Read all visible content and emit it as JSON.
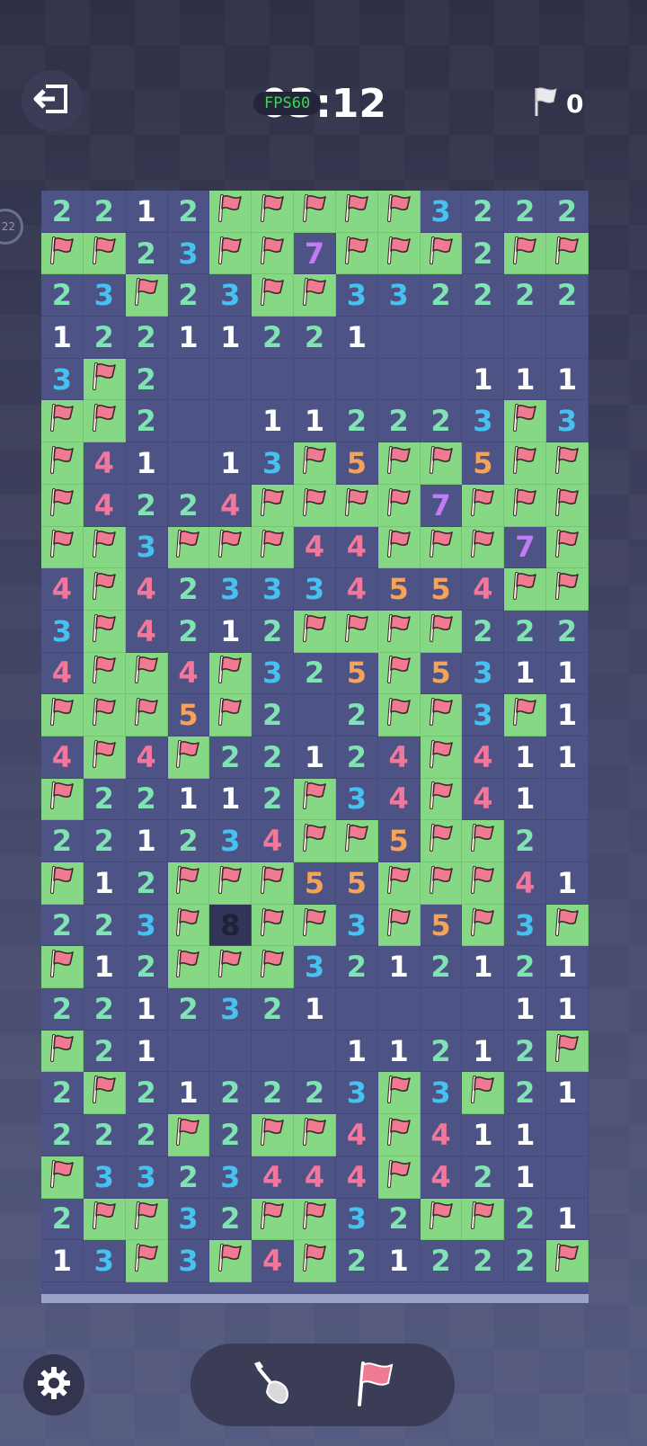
{
  "header": {
    "fps_label": "FPS60",
    "timer": "03:12",
    "flag_count": "0",
    "side_level": "22"
  },
  "colors": {
    "open_cell": "#4d5384",
    "flag_cell": "#86d884",
    "num1": "#ffffff",
    "num2": "#7fe3b4",
    "num3": "#47c2f0",
    "num4": "#f3779c",
    "num5": "#f5a25a",
    "num7": "#c07bf5",
    "num8": "#1f2236",
    "flag_red": "#f07a92"
  },
  "icons": {
    "exit": "exit-icon",
    "flag_counter": "flag-outline-icon",
    "settings": "gear-icon",
    "shovel": "shovel-icon",
    "flag_tool": "flag-icon"
  },
  "board": {
    "rows": [
      [
        "2",
        "2",
        "1",
        "2",
        "F",
        "F",
        "F",
        "F",
        "F",
        "3",
        "2",
        "2",
        "2"
      ],
      [
        "F",
        "F",
        "2",
        "3",
        "F",
        "F",
        "7",
        "F",
        "F",
        "F",
        "2",
        "F",
        "F"
      ],
      [
        "2",
        "3",
        "F",
        "2",
        "3",
        "F",
        "F",
        "3",
        "3",
        "2",
        "2",
        "2",
        "2"
      ],
      [
        "1",
        "2",
        "2",
        "1",
        "1",
        "2",
        "2",
        "1",
        "",
        "",
        "",
        "",
        ""
      ],
      [
        "3",
        "F",
        "2",
        "",
        "",
        "",
        "",
        "",
        "",
        "",
        "1",
        "1",
        "1"
      ],
      [
        "F",
        "F",
        "2",
        "",
        "",
        "1",
        "1",
        "2",
        "2",
        "2",
        "3",
        "F",
        "3"
      ],
      [
        "F",
        "4",
        "1",
        "",
        "1",
        "3",
        "F",
        "5",
        "F",
        "F",
        "5",
        "F",
        "F"
      ],
      [
        "F",
        "4",
        "2",
        "2",
        "4",
        "F",
        "F",
        "F",
        "F",
        "7",
        "F",
        "F",
        "F"
      ],
      [
        "F",
        "F",
        "3",
        "F",
        "F",
        "F",
        "4",
        "4",
        "F",
        "F",
        "F",
        "7",
        "F"
      ],
      [
        "4",
        "F",
        "4",
        "2",
        "3",
        "3",
        "3",
        "4",
        "5",
        "5",
        "4",
        "F",
        "F"
      ],
      [
        "3",
        "F",
        "4",
        "2",
        "1",
        "2",
        "F",
        "F",
        "F",
        "F",
        "2",
        "2",
        "2"
      ],
      [
        "4",
        "F",
        "F",
        "4",
        "F",
        "3",
        "2",
        "5",
        "F",
        "5",
        "3",
        "1",
        "1"
      ],
      [
        "F",
        "F",
        "F",
        "5",
        "F",
        "2",
        "",
        "2",
        "F",
        "F",
        "3",
        "F",
        "1"
      ],
      [
        "4",
        "F",
        "4",
        "F",
        "2",
        "2",
        "1",
        "2",
        "4",
        "F",
        "4",
        "1",
        "1"
      ],
      [
        "F",
        "2",
        "2",
        "1",
        "1",
        "2",
        "F",
        "3",
        "4",
        "F",
        "4",
        "1",
        ""
      ],
      [
        "2",
        "2",
        "1",
        "2",
        "3",
        "4",
        "F",
        "F",
        "5",
        "F",
        "F",
        "2",
        ""
      ],
      [
        "F",
        "1",
        "2",
        "F",
        "F",
        "F",
        "5",
        "5",
        "F",
        "F",
        "F",
        "4",
        "1"
      ],
      [
        "2",
        "2",
        "3",
        "F",
        "8",
        "F",
        "F",
        "3",
        "F",
        "5",
        "F",
        "3",
        "F"
      ],
      [
        "F",
        "1",
        "2",
        "F",
        "F",
        "F",
        "3",
        "2",
        "1",
        "2",
        "1",
        "2",
        "1"
      ],
      [
        "2",
        "2",
        "1",
        "2",
        "3",
        "2",
        "1",
        "",
        "",
        "",
        "",
        "1",
        "1"
      ],
      [
        "F",
        "2",
        "1",
        "",
        "",
        "",
        "",
        "1",
        "1",
        "2",
        "1",
        "2",
        "F"
      ],
      [
        "2",
        "F",
        "2",
        "1",
        "2",
        "2",
        "2",
        "3",
        "F",
        "3",
        "F",
        "2",
        "1"
      ],
      [
        "2",
        "2",
        "2",
        "F",
        "2",
        "F",
        "F",
        "4",
        "F",
        "4",
        "1",
        "1",
        ""
      ],
      [
        "F",
        "3",
        "3",
        "2",
        "3",
        "4",
        "4",
        "4",
        "F",
        "4",
        "2",
        "1",
        ""
      ],
      [
        "2",
        "F",
        "F",
        "3",
        "2",
        "F",
        "F",
        "3",
        "2",
        "F",
        "F",
        "2",
        "1"
      ],
      [
        "1",
        "3",
        "F",
        "3",
        "F",
        "4",
        "F",
        "2",
        "1",
        "2",
        "2",
        "2",
        "F"
      ]
    ]
  }
}
